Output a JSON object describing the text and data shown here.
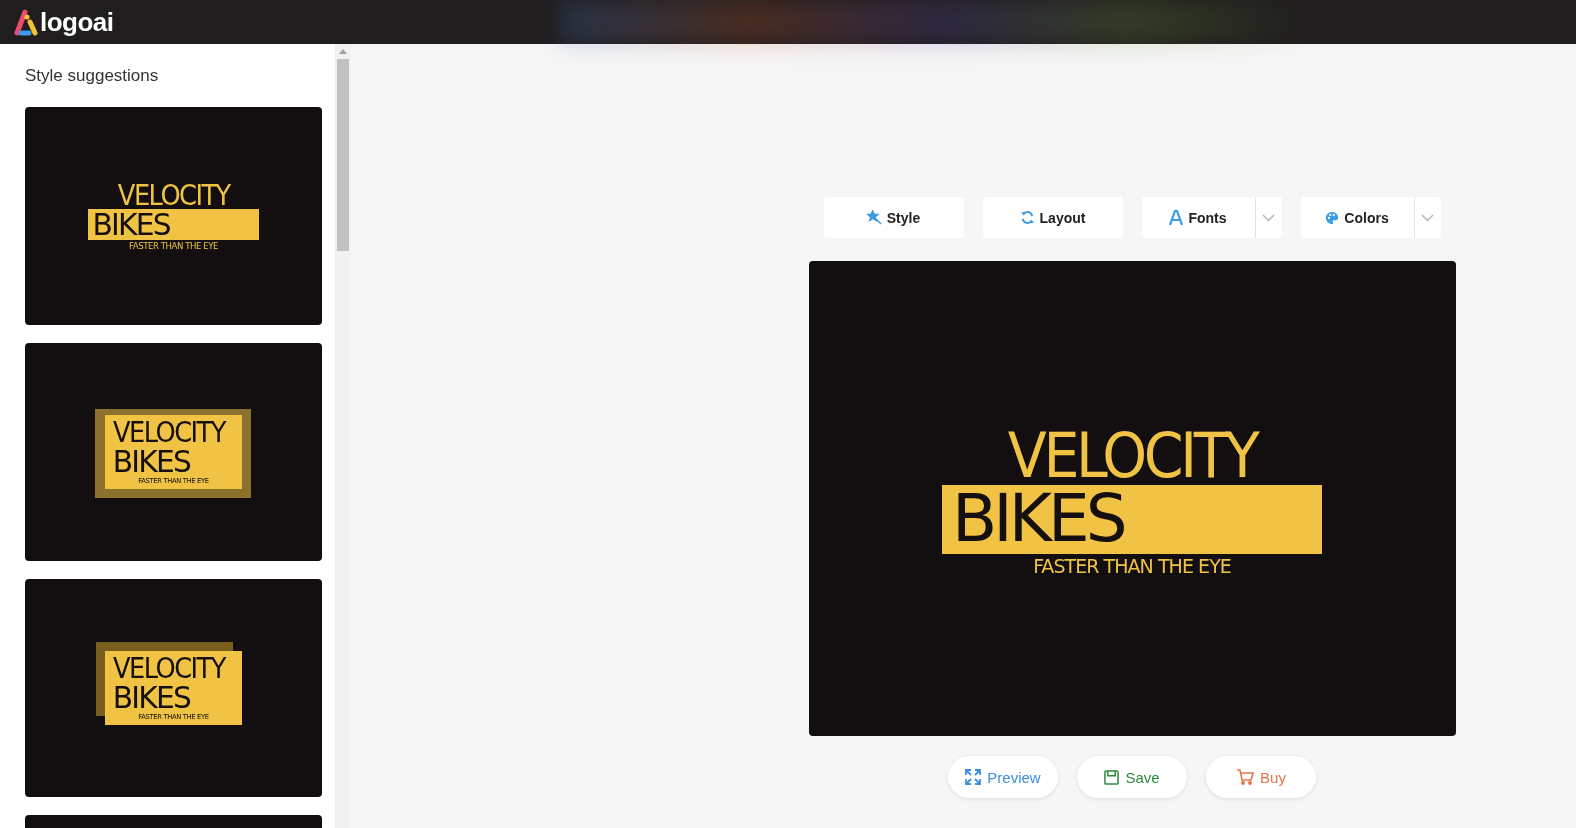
{
  "header": {
    "brand": "logoai"
  },
  "sidebar": {
    "title": "Style suggestions",
    "suggestions": [
      {
        "kind": "bar",
        "line1": "VELOCITY",
        "line2": "BIKES",
        "tagline": "FASTER THAN THE EYE"
      },
      {
        "kind": "framed",
        "line1": "VELOCITY",
        "line2": "BIKES",
        "tagline": "FASTER THAN THE EYE"
      },
      {
        "kind": "offset",
        "line1": "VELOCITY",
        "line2": "BIKES",
        "tagline": "FASTER THAN THE EYE"
      }
    ]
  },
  "toolbar": [
    {
      "label": "Style",
      "dropdown": false
    },
    {
      "label": "Layout",
      "dropdown": false
    },
    {
      "label": "Fonts",
      "dropdown": true
    },
    {
      "label": "Colors",
      "dropdown": true
    }
  ],
  "canvas": {
    "kind": "bar",
    "line1": "VELOCITY",
    "line2": "BIKES",
    "tagline": "FASTER THAN THE EYE"
  },
  "actions": [
    {
      "label": "Preview",
      "color": "#3d8ee0"
    },
    {
      "label": "Save",
      "color": "#2e8b3e"
    },
    {
      "label": "Buy",
      "color": "#e8734a"
    }
  ]
}
